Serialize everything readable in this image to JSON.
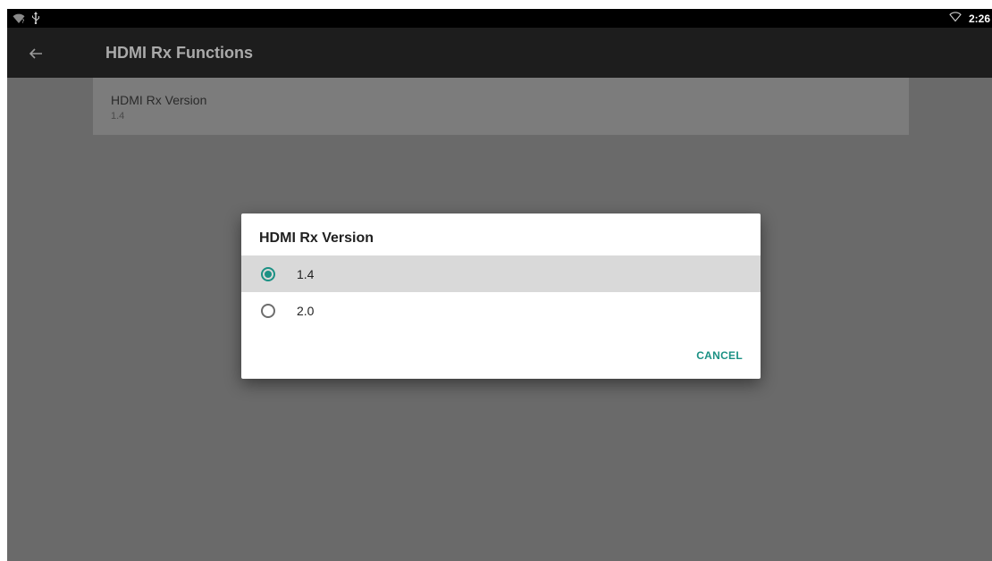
{
  "status_bar": {
    "left_icons": [
      "wifi-question-icon",
      "usb-icon"
    ],
    "right_icons": [
      "wifi-outline-icon"
    ],
    "time": "2:26"
  },
  "app_bar": {
    "back_icon": "arrow-back-icon",
    "title": "HDMI Rx Functions"
  },
  "preference": {
    "title": "HDMI Rx Version",
    "summary": "1.4"
  },
  "dialog": {
    "title": "HDMI Rx Version",
    "options": [
      {
        "label": "1.4",
        "selected": true
      },
      {
        "label": "2.0",
        "selected": false
      }
    ],
    "cancel_label": "CANCEL"
  },
  "colors": {
    "accent": "#1b9184",
    "app_bar": "#1d1d1d",
    "scrim": "#6a6a6a"
  }
}
